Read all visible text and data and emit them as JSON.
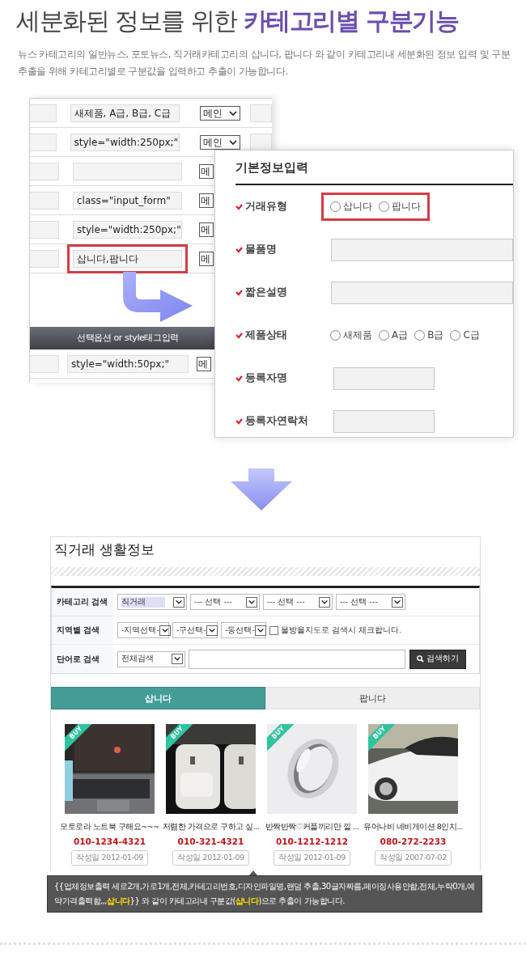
{
  "header": {
    "title": "세분화된 정보를 위한 **카테고리별 구분기능**",
    "description": "뉴스 카테고리의 일반뉴스, 포토뉴스, 직거래카테고리의 삽니다, 팝니다 와 같이 카테고리내 세분화된 정보 입력 및 구분 추출을 위해 카테고리별로 구분값을 입력하고 추출이 가능합니다."
  },
  "admin_table": {
    "rows": [
      {
        "value": "새제품, A급, B급, C급",
        "select": "메인",
        "arrow": true,
        "highlighted": false
      },
      {
        "value": "style=\"width:250px;\"",
        "select": "메인",
        "arrow": true,
        "highlighted": false
      },
      {
        "value": "",
        "select": "메",
        "arrow": false,
        "highlighted": false
      },
      {
        "value": "class=\"input_form\"",
        "select": "메",
        "arrow": false,
        "highlighted": false
      },
      {
        "value": "style=\"width:250px;\"",
        "select": "메",
        "arrow": false,
        "highlighted": false
      },
      {
        "value": "삽니다,팝니다",
        "select": "메",
        "arrow": false,
        "highlighted": true
      }
    ],
    "header_bar": "선택옵션 or style태그입력",
    "extra_row": {
      "value": "style=\"width:50px;\"",
      "select": "메"
    }
  },
  "form": {
    "title": "기본정보입력",
    "fields": [
      {
        "kind": "radio",
        "label": "거래유형",
        "highlighted": true,
        "options": [
          {
            "label": "삽니다",
            "selected": false
          },
          {
            "label": "팝니다",
            "selected": false
          }
        ]
      },
      {
        "kind": "text",
        "label": "물품명",
        "wide": true
      },
      {
        "kind": "text",
        "label": "짧은설명",
        "wide": true
      },
      {
        "kind": "radio",
        "label": "제품상태",
        "highlighted": false,
        "options": [
          {
            "label": "새제품",
            "selected": false
          },
          {
            "label": "A급",
            "selected": false
          },
          {
            "label": "B급",
            "selected": false
          },
          {
            "label": "C급",
            "selected": false
          }
        ]
      },
      {
        "kind": "text",
        "label": "등록자명",
        "wide": false
      },
      {
        "kind": "text",
        "label": "등록자연락처",
        "wide": false
      }
    ]
  },
  "board": {
    "title": "직거래 생활정보",
    "search_rows": [
      {
        "label": "카테고리 검색",
        "selects": [
          {
            "value": "직거래",
            "highlighted": true
          },
          {
            "value": "--- 선택 ---",
            "highlighted": false
          },
          {
            "value": "--- 선택 ---",
            "highlighted": false
          },
          {
            "value": "--- 선택 ---",
            "highlighted": false
          }
        ]
      },
      {
        "label": "지역별 검색",
        "selects": [
          {
            "value": "-지역선택-",
            "highlighted": false
          },
          {
            "value": "-구선택-",
            "highlighted": false
          },
          {
            "value": "-동선택-",
            "highlighted": false
          }
        ],
        "checkbox": {
          "label": "물방울지도로 검색시 체크합니다.",
          "checked": false
        }
      },
      {
        "label": "단어로 검색",
        "selects": [
          {
            "value": "전체검색",
            "highlighted": false
          }
        ],
        "input": true,
        "button": "검색하기"
      }
    ],
    "tabs": [
      {
        "label": "삽니다",
        "selected": true
      },
      {
        "label": "팝니다",
        "selected": false
      }
    ],
    "products": [
      {
        "badge": "BUY",
        "title": "모토로라 노트북 구해요~~~",
        "phone": "010-1234-4321",
        "date": "작성일 2012-01-09"
      },
      {
        "badge": "BUY",
        "title": "저렴한 가격으로 구하고 싶...",
        "phone": "010-321-4321",
        "date": "작성일 2012-01-09"
      },
      {
        "badge": "BUY",
        "title": "반짝반짝♡커플끼리만 낄 ...",
        "phone": "010-1212-1212",
        "date": "작성일 2012-01-09"
      },
      {
        "badge": "BUY",
        "title": "유어나비 네비게이션 8인치...",
        "phone": "080-272-2233",
        "date": "작성일 2007-07-02"
      }
    ],
    "note": "{{업체정보출력 세로2개,가로1개,전체,카테고리번호,디자인파일명,랜덤 추출,30글자짜름,페이징사용안함,전체,누락0개,예약가격출력함,,,**삽니다**}} 와 같이 카테고리내 구분값(**삽니다**)으로 추출이 가능합니다."
  }
}
